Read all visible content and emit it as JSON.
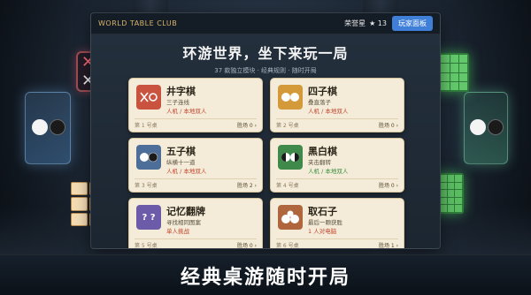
{
  "app": {
    "brand": "WORLD TABLE CLUB",
    "user_name": "荣誉星",
    "star_count": "★ 13",
    "player_panel_label": "玩家面板"
  },
  "hero": {
    "title": "环游世界，坐下来玩一局",
    "subtitle": "37 款独立模块 · 经典规则 · 随时开局"
  },
  "cards": [
    {
      "title": "井字棋",
      "desc": "三子连线",
      "mode": "人机 / 本地双人",
      "seat": "第 1 号桌",
      "wins": "胜场 0 ›",
      "icon": "tic-tac-toe-icon"
    },
    {
      "title": "四子棋",
      "desc": "叠直落子",
      "mode": "人机 / 本地双人",
      "seat": "第 2 号桌",
      "wins": "胜场 0 ›",
      "icon": "connect-four-icon"
    },
    {
      "title": "五子棋",
      "desc": "纵横十一道",
      "mode": "人机 / 本地双人",
      "seat": "第 3 号桌",
      "wins": "胜场 2 ›",
      "icon": "gomoku-icon"
    },
    {
      "title": "黑白棋",
      "desc": "夹击翻转",
      "mode": "人机 / 本地双人",
      "seat": "第 4 号桌",
      "wins": "胜场 0 ›",
      "icon": "reversi-icon"
    },
    {
      "title": "记忆翻牌",
      "desc": "寻找相同图案",
      "mode": "单人挑战",
      "seat": "第 5 号桌",
      "wins": "胜场 0 ›",
      "icon": "memory-cards-icon"
    },
    {
      "title": "取石子",
      "desc": "最后一颗获胜",
      "mode": "1 人对电脑",
      "seat": "第 6 号桌",
      "wins": "胜场 1 ›",
      "icon": "nim-stones-icon"
    }
  ],
  "caption": "经典桌游随时开局",
  "colors": {
    "accent": "#3f7fd8",
    "brand": "#d9b46a",
    "card_bg": "#f4ecd9"
  }
}
